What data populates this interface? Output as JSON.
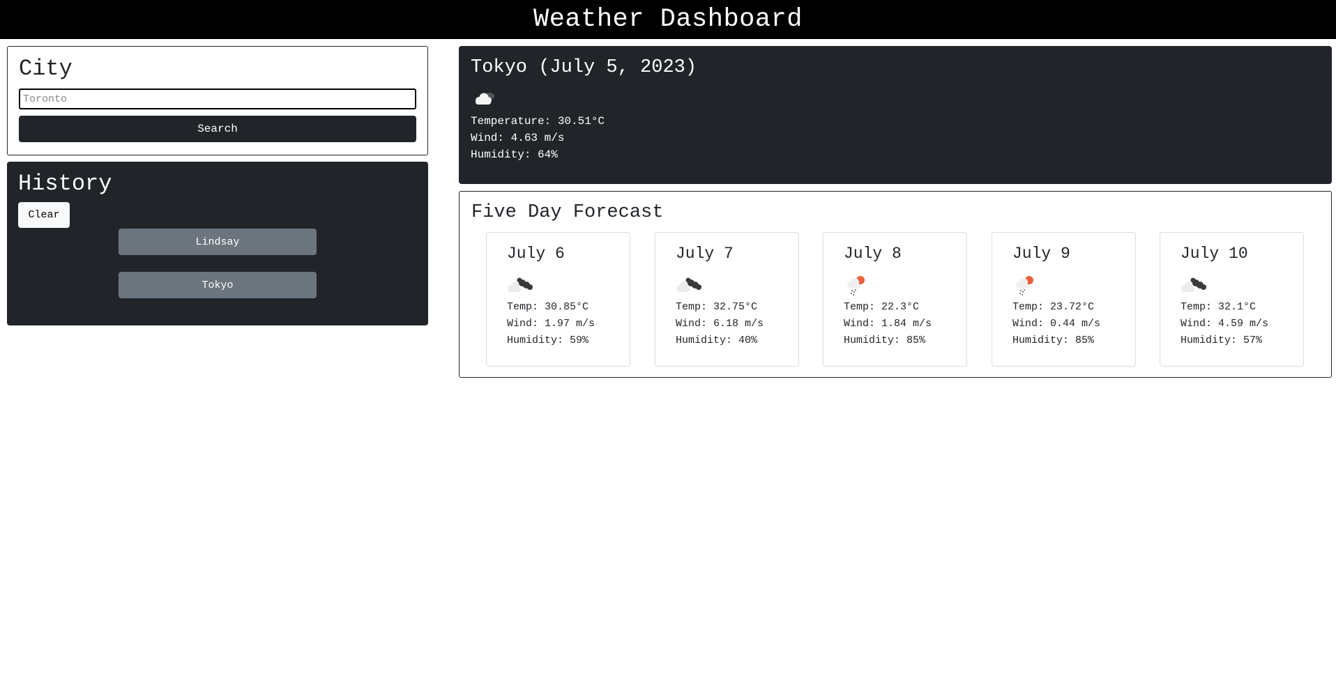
{
  "header": {
    "title": "Weather Dashboard"
  },
  "search": {
    "heading": "City",
    "placeholder": "Toronto",
    "button_label": "Search"
  },
  "history": {
    "heading": "History",
    "clear_label": "Clear",
    "items": [
      {
        "label": "Lindsay"
      },
      {
        "label": "Tokyo"
      }
    ]
  },
  "current": {
    "title": "Tokyo (July 5, 2023)",
    "icon": "broken-clouds-icon",
    "temperature": "Temperature: 30.51°C",
    "wind": "Wind: 4.63 m/s",
    "humidity": "Humidity: 64%"
  },
  "forecast": {
    "heading": "Five Day Forecast",
    "days": [
      {
        "date": "July 6",
        "icon": "broken-clouds-icon",
        "temp": "Temp: 30.85°C",
        "wind": "Wind: 1.97 m/s",
        "humidity": "Humidity: 59%"
      },
      {
        "date": "July 7",
        "icon": "broken-clouds-icon",
        "temp": "Temp: 32.75°C",
        "wind": "Wind: 6.18 m/s",
        "humidity": "Humidity: 40%"
      },
      {
        "date": "July 8",
        "icon": "rain-sun-icon",
        "temp": "Temp: 22.3°C",
        "wind": "Wind: 1.84 m/s",
        "humidity": "Humidity: 85%"
      },
      {
        "date": "July 9",
        "icon": "rain-sun-icon",
        "temp": "Temp: 23.72°C",
        "wind": "Wind: 0.44 m/s",
        "humidity": "Humidity: 85%"
      },
      {
        "date": "July 10",
        "icon": "broken-clouds-icon",
        "temp": "Temp: 32.1°C",
        "wind": "Wind: 4.59 m/s",
        "humidity": "Humidity: 57%"
      }
    ]
  },
  "colors": {
    "header_bg": "#000000",
    "dark_panel": "#212529",
    "history_button": "#6c757d",
    "light_button": "#f8f9fa",
    "sun_accent": "#e8613c"
  }
}
